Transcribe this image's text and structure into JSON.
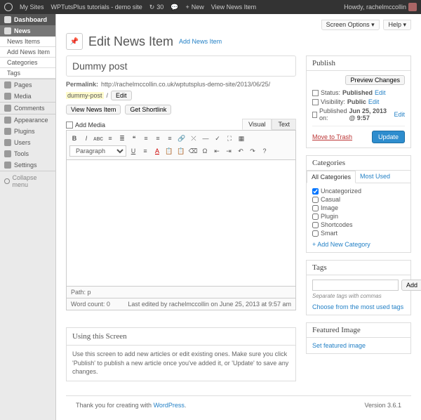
{
  "adminbar": {
    "my_sites": "My Sites",
    "site_name": "WPTutsPlus tutorials - demo site",
    "updates": "30",
    "comments": "",
    "new": "New",
    "view": "View News Item",
    "howdy": "Howdy, rachelmccollin"
  },
  "screen_opts": {
    "screen": "Screen Options",
    "help": "Help"
  },
  "sidebar": {
    "dashboard": "Dashboard",
    "news": "News",
    "subs": [
      "News Items",
      "Add News Item",
      "Categories",
      "Tags"
    ],
    "pages": "Pages",
    "media": "Media",
    "comments": "Comments",
    "appearance": "Appearance",
    "plugins": "Plugins",
    "users": "Users",
    "tools": "Tools",
    "settings": "Settings",
    "collapse": "Collapse menu"
  },
  "page": {
    "title": "Edit News Item",
    "addnew": "Add News Item"
  },
  "post": {
    "title": "Dummy post",
    "permalink_label": "Permalink:",
    "permalink_base": "http://rachelmccollin.co.uk/wptutsplus-demo-site/2013/06/25/",
    "permalink_slug": "dummy-post",
    "edit": "Edit",
    "view": "View News Item",
    "shortlink": "Get Shortlink",
    "addmedia": "Add Media",
    "tab_visual": "Visual",
    "tab_text": "Text",
    "paragraph": "Paragraph",
    "path_label": "Path:",
    "path_val": "p",
    "wordcount_label": "Word count:",
    "wordcount": "0",
    "lastedit": "Last edited by rachelmccollin on June 25, 2013 at 9:57 am"
  },
  "help": {
    "title": "Using this Screen",
    "body": "Use this screen to add new articles or edit existing ones. Make sure you click 'Publish' to publish a new article once you've added it, or 'Update' to save any changes."
  },
  "publish": {
    "title": "Publish",
    "preview": "Preview Changes",
    "status_label": "Status:",
    "status": "Published",
    "vis_label": "Visibility:",
    "vis": "Public",
    "date_label": "Published on:",
    "date": "Jun 25, 2013 @ 9:57",
    "edit": "Edit",
    "trash": "Move to Trash",
    "update": "Update"
  },
  "categories": {
    "title": "Categories",
    "tab_all": "All Categories",
    "tab_used": "Most Used",
    "items": [
      {
        "label": "Uncategorized",
        "checked": true
      },
      {
        "label": "Casual",
        "checked": false
      },
      {
        "label": "Image",
        "checked": false
      },
      {
        "label": "Plugin",
        "checked": false
      },
      {
        "label": "Shortcodes",
        "checked": false
      },
      {
        "label": "Smart",
        "checked": false
      }
    ],
    "addnew": "+ Add New Category"
  },
  "tags": {
    "title": "Tags",
    "add": "Add",
    "hint": "Separate tags with commas",
    "choose": "Choose from the most used tags"
  },
  "featured": {
    "title": "Featured Image",
    "set": "Set featured image"
  },
  "footer": {
    "thanks": "Thank you for creating with ",
    "wp": "WordPress",
    "version": "Version 3.6.1"
  }
}
